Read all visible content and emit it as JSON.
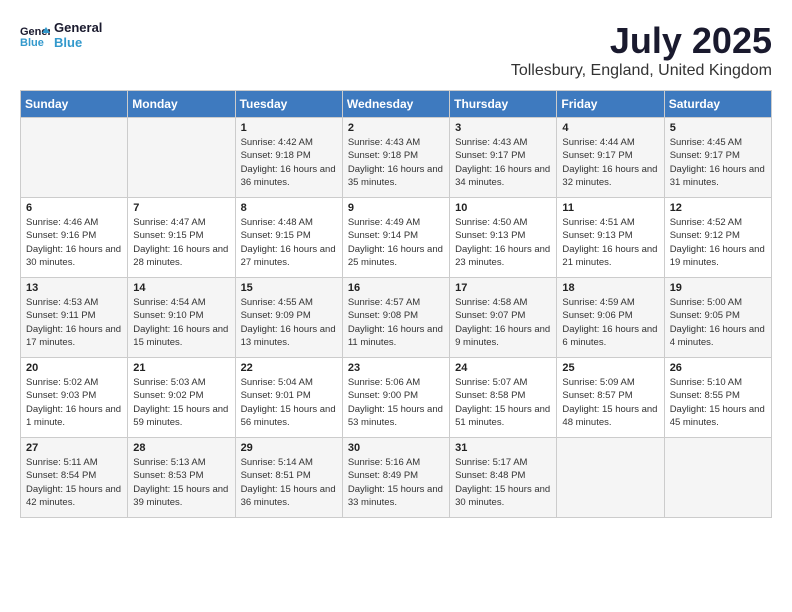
{
  "logo": {
    "line1": "General",
    "line2": "Blue"
  },
  "title": "July 2025",
  "subtitle": "Tollesbury, England, United Kingdom",
  "days_of_week": [
    "Sunday",
    "Monday",
    "Tuesday",
    "Wednesday",
    "Thursday",
    "Friday",
    "Saturday"
  ],
  "weeks": [
    [
      {
        "day": "",
        "info": ""
      },
      {
        "day": "",
        "info": ""
      },
      {
        "day": "1",
        "info": "Sunrise: 4:42 AM\nSunset: 9:18 PM\nDaylight: 16 hours and 36 minutes."
      },
      {
        "day": "2",
        "info": "Sunrise: 4:43 AM\nSunset: 9:18 PM\nDaylight: 16 hours and 35 minutes."
      },
      {
        "day": "3",
        "info": "Sunrise: 4:43 AM\nSunset: 9:17 PM\nDaylight: 16 hours and 34 minutes."
      },
      {
        "day": "4",
        "info": "Sunrise: 4:44 AM\nSunset: 9:17 PM\nDaylight: 16 hours and 32 minutes."
      },
      {
        "day": "5",
        "info": "Sunrise: 4:45 AM\nSunset: 9:17 PM\nDaylight: 16 hours and 31 minutes."
      }
    ],
    [
      {
        "day": "6",
        "info": "Sunrise: 4:46 AM\nSunset: 9:16 PM\nDaylight: 16 hours and 30 minutes."
      },
      {
        "day": "7",
        "info": "Sunrise: 4:47 AM\nSunset: 9:15 PM\nDaylight: 16 hours and 28 minutes."
      },
      {
        "day": "8",
        "info": "Sunrise: 4:48 AM\nSunset: 9:15 PM\nDaylight: 16 hours and 27 minutes."
      },
      {
        "day": "9",
        "info": "Sunrise: 4:49 AM\nSunset: 9:14 PM\nDaylight: 16 hours and 25 minutes."
      },
      {
        "day": "10",
        "info": "Sunrise: 4:50 AM\nSunset: 9:13 PM\nDaylight: 16 hours and 23 minutes."
      },
      {
        "day": "11",
        "info": "Sunrise: 4:51 AM\nSunset: 9:13 PM\nDaylight: 16 hours and 21 minutes."
      },
      {
        "day": "12",
        "info": "Sunrise: 4:52 AM\nSunset: 9:12 PM\nDaylight: 16 hours and 19 minutes."
      }
    ],
    [
      {
        "day": "13",
        "info": "Sunrise: 4:53 AM\nSunset: 9:11 PM\nDaylight: 16 hours and 17 minutes."
      },
      {
        "day": "14",
        "info": "Sunrise: 4:54 AM\nSunset: 9:10 PM\nDaylight: 16 hours and 15 minutes."
      },
      {
        "day": "15",
        "info": "Sunrise: 4:55 AM\nSunset: 9:09 PM\nDaylight: 16 hours and 13 minutes."
      },
      {
        "day": "16",
        "info": "Sunrise: 4:57 AM\nSunset: 9:08 PM\nDaylight: 16 hours and 11 minutes."
      },
      {
        "day": "17",
        "info": "Sunrise: 4:58 AM\nSunset: 9:07 PM\nDaylight: 16 hours and 9 minutes."
      },
      {
        "day": "18",
        "info": "Sunrise: 4:59 AM\nSunset: 9:06 PM\nDaylight: 16 hours and 6 minutes."
      },
      {
        "day": "19",
        "info": "Sunrise: 5:00 AM\nSunset: 9:05 PM\nDaylight: 16 hours and 4 minutes."
      }
    ],
    [
      {
        "day": "20",
        "info": "Sunrise: 5:02 AM\nSunset: 9:03 PM\nDaylight: 16 hours and 1 minute."
      },
      {
        "day": "21",
        "info": "Sunrise: 5:03 AM\nSunset: 9:02 PM\nDaylight: 15 hours and 59 minutes."
      },
      {
        "day": "22",
        "info": "Sunrise: 5:04 AM\nSunset: 9:01 PM\nDaylight: 15 hours and 56 minutes."
      },
      {
        "day": "23",
        "info": "Sunrise: 5:06 AM\nSunset: 9:00 PM\nDaylight: 15 hours and 53 minutes."
      },
      {
        "day": "24",
        "info": "Sunrise: 5:07 AM\nSunset: 8:58 PM\nDaylight: 15 hours and 51 minutes."
      },
      {
        "day": "25",
        "info": "Sunrise: 5:09 AM\nSunset: 8:57 PM\nDaylight: 15 hours and 48 minutes."
      },
      {
        "day": "26",
        "info": "Sunrise: 5:10 AM\nSunset: 8:55 PM\nDaylight: 15 hours and 45 minutes."
      }
    ],
    [
      {
        "day": "27",
        "info": "Sunrise: 5:11 AM\nSunset: 8:54 PM\nDaylight: 15 hours and 42 minutes."
      },
      {
        "day": "28",
        "info": "Sunrise: 5:13 AM\nSunset: 8:53 PM\nDaylight: 15 hours and 39 minutes."
      },
      {
        "day": "29",
        "info": "Sunrise: 5:14 AM\nSunset: 8:51 PM\nDaylight: 15 hours and 36 minutes."
      },
      {
        "day": "30",
        "info": "Sunrise: 5:16 AM\nSunset: 8:49 PM\nDaylight: 15 hours and 33 minutes."
      },
      {
        "day": "31",
        "info": "Sunrise: 5:17 AM\nSunset: 8:48 PM\nDaylight: 15 hours and 30 minutes."
      },
      {
        "day": "",
        "info": ""
      },
      {
        "day": "",
        "info": ""
      }
    ]
  ]
}
